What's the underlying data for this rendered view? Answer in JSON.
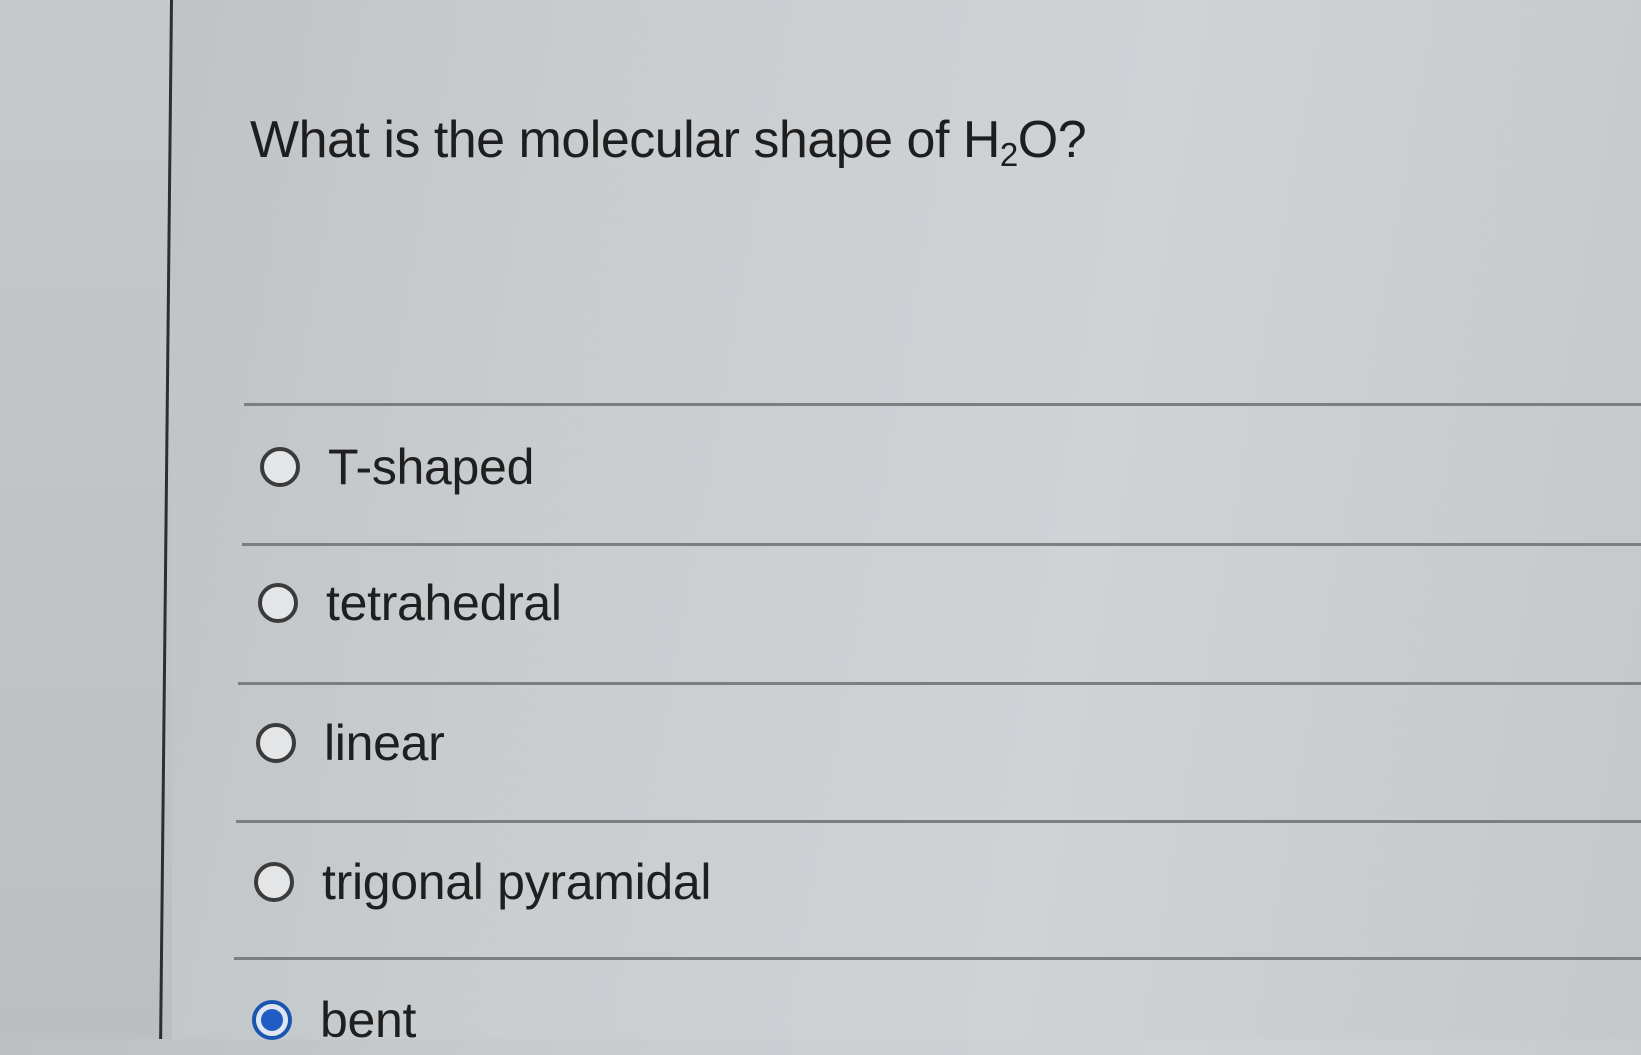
{
  "question": {
    "prefix": "What is the molecular shape of H",
    "subscript": "2",
    "suffix": "O?"
  },
  "options": [
    {
      "label": "T-shaped",
      "selected": false
    },
    {
      "label": "tetrahedral",
      "selected": false
    },
    {
      "label": "linear",
      "selected": false
    },
    {
      "label": "trigonal pyramidal",
      "selected": false
    },
    {
      "label": "bent",
      "selected": true
    }
  ],
  "colors": {
    "selected_radio": "#1f5dc4",
    "radio_border": "#3b3b3b",
    "divider": "#7c7f82"
  }
}
